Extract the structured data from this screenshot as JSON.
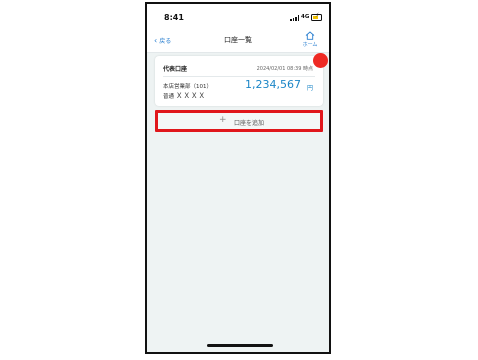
{
  "statusbar": {
    "time": "8:41",
    "network": "4G"
  },
  "navbar": {
    "back_label": "戻る",
    "title": "口座一覧",
    "home_label": "ホーム"
  },
  "account_card": {
    "name": "代表口座",
    "timestamp": "2024/02/01 08:39 時点",
    "branch": "本店営業部（101）",
    "type": "普通",
    "number": "ＸＸＸＸ",
    "balance": "1,234,567",
    "currency": "円"
  },
  "add_account": {
    "icon": "+",
    "label": "口座を追加"
  },
  "colors": {
    "accent": "#2a7fd0",
    "balance": "#1c86c7",
    "highlight": "#e0161b",
    "badge": "#ee2a24",
    "background": "#eef3f3"
  },
  "icons": [
    "back-chevron-icon",
    "home-icon",
    "signal-icon",
    "battery-icon",
    "plus-icon"
  ]
}
